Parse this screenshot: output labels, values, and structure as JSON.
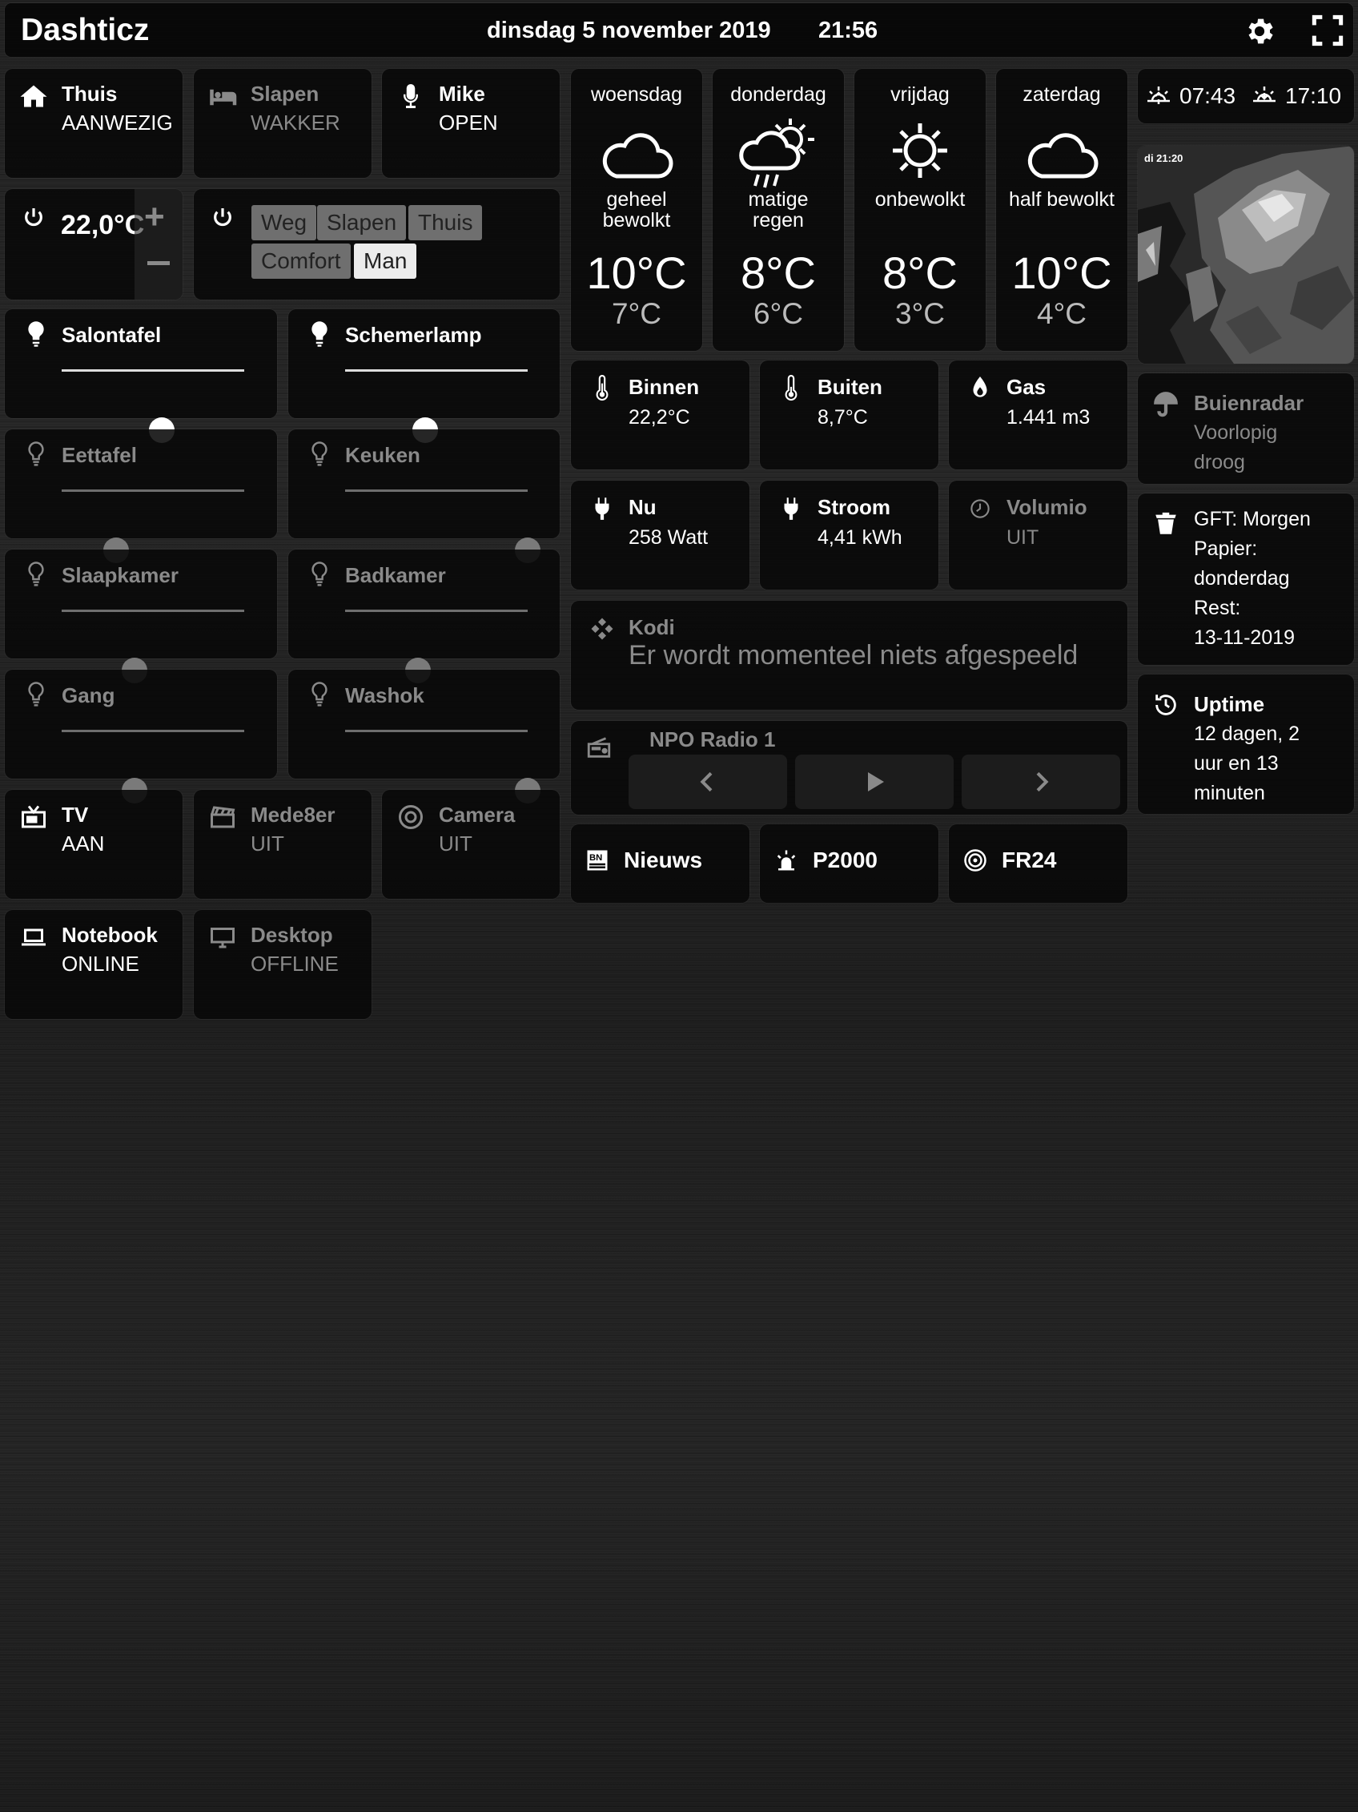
{
  "header": {
    "title": "Dashticz",
    "date": "dinsdag 5 november 2019",
    "time": "21:56"
  },
  "switches": {
    "thuis": {
      "title": "Thuis",
      "status": "AANWEZIG"
    },
    "slapen": {
      "title": "Slapen",
      "status": "WAKKER"
    },
    "mike": {
      "title": "Mike",
      "status": "OPEN"
    },
    "tv": {
      "title": "TV",
      "status": "AAN"
    },
    "mede8er": {
      "title": "Mede8er",
      "status": "UIT"
    },
    "camera": {
      "title": "Camera",
      "status": "UIT"
    },
    "notebook": {
      "title": "Notebook",
      "status": "ONLINE"
    },
    "desktop": {
      "title": "Desktop",
      "status": "OFFLINE"
    }
  },
  "thermostat": {
    "value": "22,0°C",
    "plus": "+"
  },
  "modes": {
    "weg": "Weg",
    "slapen": "Slapen",
    "thuis": "Thuis",
    "comfort": "Comfort",
    "man": "Man",
    "active": "Man"
  },
  "dimmers": {
    "salontafel": {
      "title": "Salontafel",
      "level": 0.55
    },
    "schemerlamp": {
      "title": "Schemerlamp",
      "level": 0.44
    },
    "eettafel": {
      "title": "Eettafel",
      "level": 0.3
    },
    "keuken": {
      "title": "Keuken",
      "level": 1.0
    },
    "slaapkamer": {
      "title": "Slaapkamer",
      "level": 0.4
    },
    "badkamer": {
      "title": "Badkamer",
      "level": 0.4
    },
    "gang": {
      "title": "Gang",
      "level": 0.4
    },
    "washok": {
      "title": "Washok",
      "level": 1.0
    }
  },
  "weather": [
    {
      "day": "woensdag",
      "desc1": "geheel",
      "desc2": "bewolkt",
      "high": "10°C",
      "low": "7°C",
      "icon": "cloud-icon"
    },
    {
      "day": "donderdag",
      "desc1": "matige",
      "desc2": "regen",
      "high": "8°C",
      "low": "6°C",
      "icon": "rain-sun-icon"
    },
    {
      "day": "vrijdag",
      "desc1": "onbewolkt",
      "desc2": "",
      "high": "8°C",
      "low": "3°C",
      "icon": "sun-icon"
    },
    {
      "day": "zaterdag",
      "desc1": "half bewolkt",
      "desc2": "",
      "high": "10°C",
      "low": "4°C",
      "icon": "cloud-icon"
    }
  ],
  "sun": {
    "rise": "07:43",
    "set": "17:10"
  },
  "radar": {
    "stamp": "di 21:20"
  },
  "sensors": {
    "binnen": {
      "title": "Binnen",
      "value": "22,2°C"
    },
    "buiten": {
      "title": "Buiten",
      "value": "8,7°C"
    },
    "gas": {
      "title": "Gas",
      "value": "1.441 m3"
    },
    "nu": {
      "title": "Nu",
      "value": "258 Watt"
    },
    "stroom": {
      "title": "Stroom",
      "value": "4,41 kWh"
    },
    "volumio": {
      "title": "Volumio",
      "value": "UIT"
    }
  },
  "buienradar": {
    "title": "Buienradar",
    "line1": "Voorlopig",
    "line2": "droog"
  },
  "garbage": {
    "line1": "GFT: Morgen",
    "line2": "Papier:",
    "line3": "donderdag",
    "line4": "Rest:",
    "line5": "13-11-2019"
  },
  "uptime": {
    "title": "Uptime",
    "line1": "12 dagen, 2",
    "line2": "uur en 13",
    "line3": "minuten"
  },
  "kodi": {
    "title": "Kodi",
    "text": "Er wordt momenteel niets afgespeeld"
  },
  "radio": {
    "title": "NPO Radio 1"
  },
  "links": {
    "nieuws": "Nieuws",
    "p2000": "P2000",
    "fr24": "FR24"
  },
  "colors": {
    "tile": "#080808",
    "inactive": "#8a8a8a",
    "active_button": "#ececec",
    "button": "#6f6f6f"
  }
}
